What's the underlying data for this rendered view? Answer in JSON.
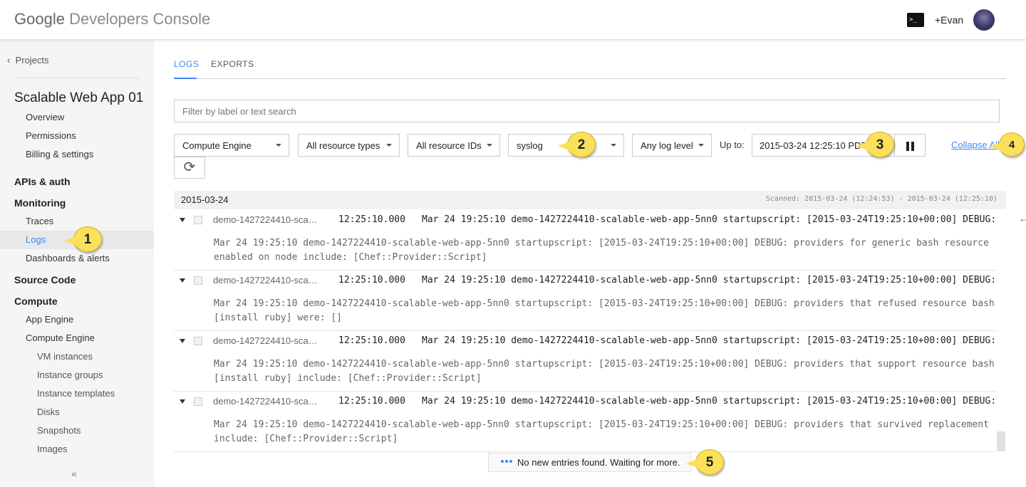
{
  "header": {
    "logo_google": "Google",
    "logo_product": "Developers Console",
    "terminal_glyph": ">_",
    "user": "+Evan"
  },
  "sidebar": {
    "back_link": "Projects",
    "project_name": "Scalable Web App 01",
    "project_items": [
      "Overview",
      "Permissions",
      "Billing & settings"
    ],
    "apis_auth": "APIs & auth",
    "monitoring": "Monitoring",
    "monitoring_items": [
      "Traces",
      "Logs",
      "Dashboards & alerts"
    ],
    "source_code": "Source Code",
    "compute": "Compute",
    "compute_items": [
      "App Engine",
      "Compute Engine"
    ],
    "compute_engine_items": [
      "VM instances",
      "Instance groups",
      "Instance templates",
      "Disks",
      "Snapshots",
      "Images"
    ],
    "active_item": "Logs",
    "collapse_glyph": "«"
  },
  "tabs": [
    {
      "label": "LOGS",
      "active": true
    },
    {
      "label": "EXPORTS",
      "active": false
    }
  ],
  "filter": {
    "placeholder": "Filter by label or text search"
  },
  "toolbar": {
    "service": "Compute Engine",
    "resource_types": "All resource types",
    "resource_ids": "All resource IDs",
    "log_name": "syslog",
    "log_level": "Any log level",
    "upto_label": "Up to:",
    "upto_value": "2015-03-24 12:25:10 PDT",
    "collapse_all": "Collapse All",
    "refresh_glyph": "⟳"
  },
  "log_view": {
    "date": "2015-03-24",
    "scanned": "Scanned: 2015-03-24 (12:24:53) - 2015-03-24 (12:25:10)",
    "entries": [
      {
        "resource": "demo-1427224410-sca…",
        "time": "12:25:10.000",
        "summary": "Mar 24 19:25:10 demo-1427224410-scalable-web-app-5nn0 startupscript: [2015-03-24T19:25:10+00:00] DEBUG: providers for generic bash resource enabled",
        "detail": "Mar 24 19:25:10 demo-1427224410-scalable-web-app-5nn0 startupscript: [2015-03-24T19:25:10+00:00] DEBUG: providers for generic bash resource enabled on node include: [Chef::Provider::Script]"
      },
      {
        "resource": "demo-1427224410-sca…",
        "time": "12:25:10.000",
        "summary": "Mar 24 19:25:10 demo-1427224410-scalable-web-app-5nn0 startupscript: [2015-03-24T19:25:10+00:00] DEBUG: providers that refused resource",
        "detail": "Mar 24 19:25:10 demo-1427224410-scalable-web-app-5nn0 startupscript: [2015-03-24T19:25:10+00:00] DEBUG: providers that refused resource bash[install ruby] were: []"
      },
      {
        "resource": "demo-1427224410-sca…",
        "time": "12:25:10.000",
        "summary": "Mar 24 19:25:10 demo-1427224410-scalable-web-app-5nn0 startupscript: [2015-03-24T19:25:10+00:00] DEBUG: providers that support resource",
        "detail": "Mar 24 19:25:10 demo-1427224410-scalable-web-app-5nn0 startupscript: [2015-03-24T19:25:10+00:00] DEBUG: providers that support resource bash[install ruby] include: [Chef::Provider::Script]"
      },
      {
        "resource": "demo-1427224410-sca…",
        "time": "12:25:10.000",
        "summary": "Mar 24 19:25:10 demo-1427224410-scalable-web-app-5nn0 startupscript: [2015-03-24T19:25:10+00:00] DEBUG: providers that survived replacement",
        "detail": "Mar 24 19:25:10 demo-1427224410-scalable-web-app-5nn0 startupscript: [2015-03-24T19:25:10+00:00] DEBUG: providers that survived replacement include: [Chef::Provider::Script]"
      }
    ],
    "status": "No new entries found. Waiting for more."
  },
  "callouts": [
    "1",
    "2",
    "3",
    "4",
    "5"
  ],
  "colors": {
    "accent": "#4285f4",
    "callout": "#fbe05a"
  }
}
